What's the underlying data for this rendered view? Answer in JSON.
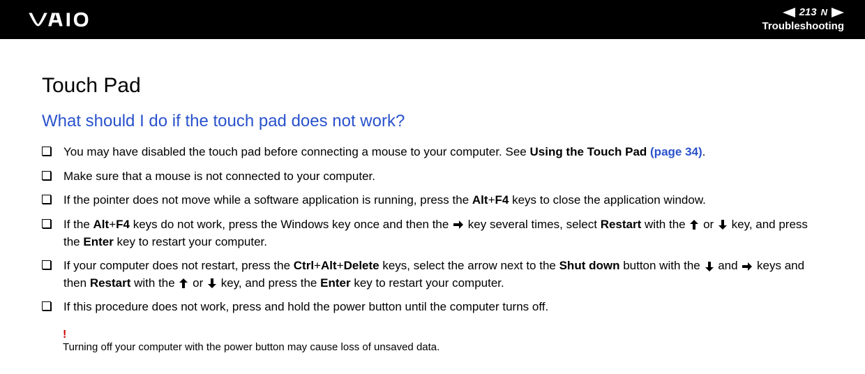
{
  "header": {
    "page_number": "213",
    "nav_letter": "N",
    "section": "Troubleshooting"
  },
  "content": {
    "heading": "Touch Pad",
    "question": "What should I do if the touch pad does not work?",
    "bullets": {
      "b1_p1": "You may have disabled the touch pad before connecting a mouse to your computer. See ",
      "b1_p2": "Using the Touch Pad",
      "b1_p3": " (page 34)",
      "b1_p4": ".",
      "b2": "Make sure that a mouse is not connected to your computer.",
      "b3_p1": "If the pointer does not move while a software application is running, press the ",
      "b3_p2": "Alt",
      "b3_p3": "+",
      "b3_p4": "F4",
      "b3_p5": " keys to close the application window.",
      "b4_p1": "If the ",
      "b4_p2": "Alt",
      "b4_p3": "+",
      "b4_p4": "F4",
      "b4_p5": " keys do not work, press the Windows key once and then the ",
      "b4_p6": " key several times, select ",
      "b4_p7": "Restart",
      "b4_p8": " with the ",
      "b4_p9": " or ",
      "b4_p10": " key, and press the ",
      "b4_p11": "Enter",
      "b4_p12": " key to restart your computer.",
      "b5_p1": "If your computer does not restart, press the ",
      "b5_p2": "Ctrl",
      "b5_p3": "+",
      "b5_p4": "Alt",
      "b5_p5": "+",
      "b5_p6": "Delete",
      "b5_p7": " keys, select the arrow next to the ",
      "b5_p8": "Shut down",
      "b5_p9": " button with the ",
      "b5_p10": " and ",
      "b5_p11": " keys and then ",
      "b5_p12": "Restart",
      "b5_p13": " with the ",
      "b5_p14": " or ",
      "b5_p15": " key, and press the ",
      "b5_p16": "Enter",
      "b5_p17": " key to restart your computer.",
      "b6": "If this procedure does not work, press and hold the power button until the computer turns off."
    },
    "warning_mark": "!",
    "warning_text": "Turning off your computer with the power button may cause loss of unsaved data."
  }
}
